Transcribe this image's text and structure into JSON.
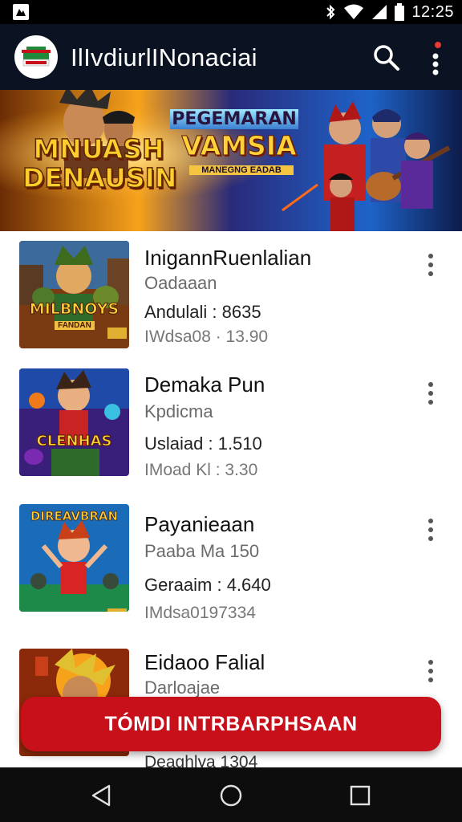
{
  "status_bar": {
    "time": "12:25"
  },
  "app_bar": {
    "title": "IlIvdiurlINonaciai"
  },
  "banner": {
    "title_line1": "MNUASH",
    "title_line2": "DENAUSIN",
    "subtitle_top": "PEGEMARAN",
    "subtitle_main": "VAMSIA",
    "subtitle_small": "MANEGNG EADAB"
  },
  "items": [
    {
      "title": "InigannRuenlalian",
      "subtitle": "Oadaaan",
      "rating": "Andulali : 8635",
      "meta": "IWdsa08 · 13.90",
      "thumb_label": "MILBNOYS",
      "thumb_sub": "FANDAN"
    },
    {
      "title": "Demaka Pun",
      "subtitle": "Kpdicma",
      "rating": "Uslaiad : 1.510",
      "meta": "IMoad Kl : 3.30",
      "thumb_label": "CLENHAS"
    },
    {
      "title": "Payanieaan",
      "subtitle": "Paaba Ma 150",
      "rating": "Geraaim : 4.640",
      "meta": "IMdsa0197334",
      "thumb_label": "DIREAVBRAN"
    },
    {
      "title": "Eidaoo Falial",
      "subtitle": "Darloajae",
      "rating": "",
      "meta": "Deaghlya 1304",
      "thumb_label": ""
    }
  ],
  "install_button": {
    "label": "TÓMDI INTRBARPHSAAN"
  },
  "colors": {
    "app_bar": "#0b1322",
    "accent": "#c8101a",
    "nav": "#0d0d0d"
  },
  "icons": [
    "status-app-icon",
    "bluetooth-icon",
    "wifi-icon",
    "signal-icon",
    "battery-icon",
    "search-icon",
    "more-vert-icon",
    "back-icon",
    "home-icon",
    "recents-icon"
  ]
}
